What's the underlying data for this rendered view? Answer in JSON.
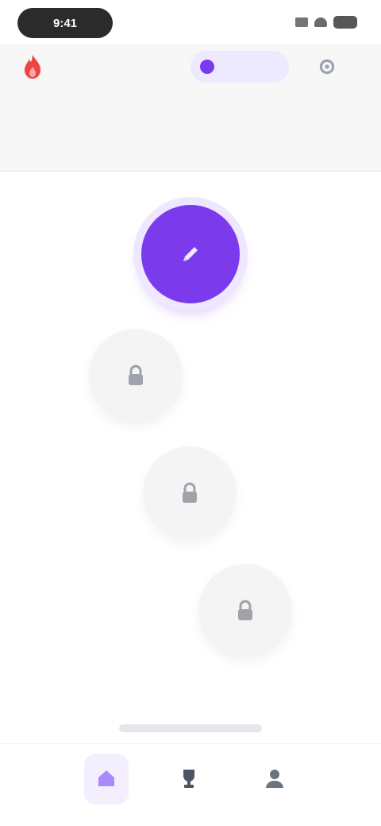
{
  "status_bar": {
    "time": "9:41"
  },
  "header": {
    "streak_count": "",
    "pro_label": "",
    "unit_subtitle": "",
    "unit_title": ""
  },
  "path": {
    "nodes": [
      {
        "state": "active",
        "icon": "pencil-icon"
      },
      {
        "state": "locked",
        "icon": "lock-icon"
      },
      {
        "state": "locked",
        "icon": "lock-icon"
      },
      {
        "state": "locked",
        "icon": "lock-icon"
      }
    ]
  },
  "bottom_nav": {
    "items": [
      {
        "icon": "home-icon",
        "label": "",
        "active": true
      },
      {
        "icon": "trophy-icon",
        "label": "",
        "active": false
      },
      {
        "icon": "profile-icon",
        "label": "",
        "active": false
      }
    ]
  },
  "colors": {
    "accent": "#7c3aed",
    "accent_soft": "#ede9fe",
    "locked_node": "#f4f4f5",
    "flame": "#ef4444"
  }
}
